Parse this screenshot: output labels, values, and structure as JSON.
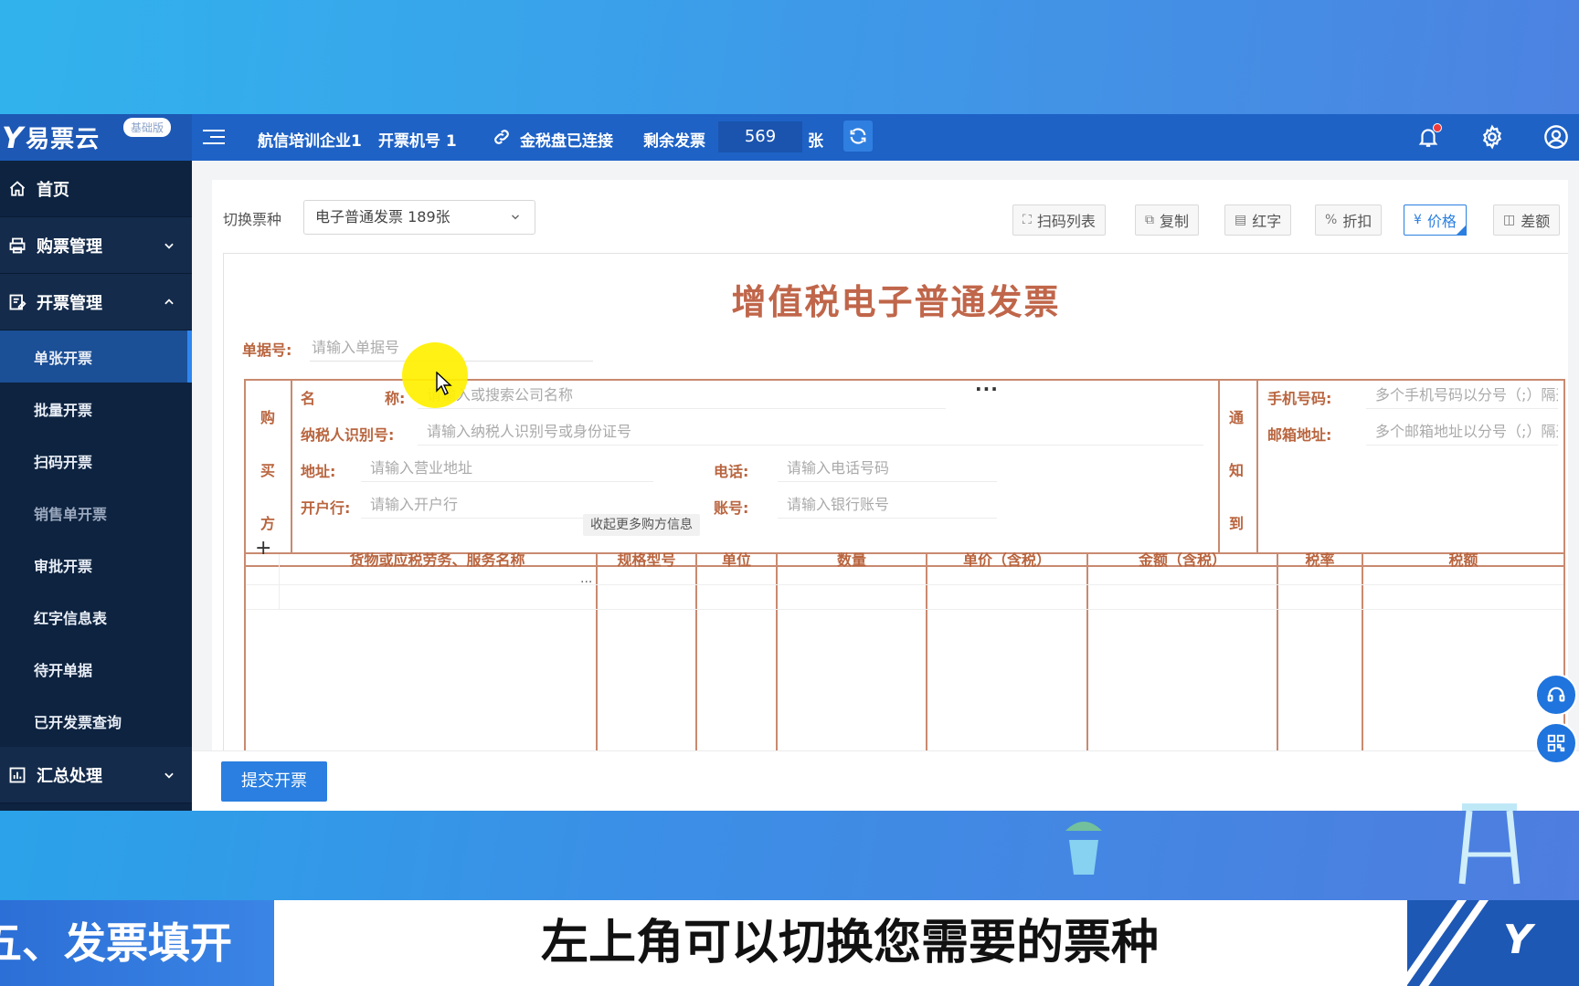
{
  "topbar": {
    "logo_mark": "Y",
    "logo_text": "易票云",
    "edition": "基础版",
    "company": "航信培训企业1",
    "machine": "开票机号 1",
    "tax_disk": "金税盘已连接",
    "remaining_label": "剩余发票",
    "remaining_count": "569",
    "remaining_unit": "张"
  },
  "sidebar": {
    "home": "首页",
    "purchase": "购票管理",
    "issue": "开票管理",
    "items": [
      "单张开票",
      "批量开票",
      "扫码开票",
      "销售单开票",
      "审批开票",
      "红字信息表",
      "待开单据",
      "已开发票查询"
    ],
    "summary": "汇总处理"
  },
  "toolbar": {
    "switch_label": "切换票种",
    "ticket_type": "电子普通发票 189张",
    "buttons": [
      "扫码列表",
      "复制",
      "红字",
      "折扣",
      "价格",
      "差额"
    ]
  },
  "invoice": {
    "title": "增值税电子普通发票",
    "doc_no_label": "单据号:",
    "doc_no_placeholder": "请输入单据号",
    "buyer_chars": [
      "购",
      "买",
      "方"
    ],
    "name_label_a": "名",
    "name_label_b": "称:",
    "name_placeholder": "请输入或搜索公司名称",
    "taxid_label": "纳税人识别号:",
    "taxid_placeholder": "请输入纳税人识别号或身份证号",
    "address_label": "地址:",
    "address_placeholder": "请输入营业地址",
    "phone_label": "电话:",
    "phone_placeholder": "请输入电话号码",
    "bank_label": "开户行:",
    "bank_placeholder": "请输入开户行",
    "account_label": "账号:",
    "account_placeholder": "请输入银行账号",
    "collapse_text": "收起更多购方信息",
    "notify_chars": [
      "通",
      "知",
      "到"
    ],
    "mobile_label": "手机号码:",
    "mobile_placeholder": "多个手机号码以分号（;）隔开",
    "email_label": "邮箱地址:",
    "email_placeholder": "多个邮箱地址以分号（;）隔开",
    "add_row": "+",
    "columns": [
      "货物或应税劳务、服务名称",
      "规格型号",
      "单位",
      "数量",
      "单价（含税）",
      "金额（含税）",
      "税率",
      "税额"
    ]
  },
  "footer": {
    "submit": "提交开票"
  },
  "caption": {
    "section": "五、发票填开",
    "text": "左上角可以切换您需要的票种",
    "corner_logo": "Y"
  },
  "colors": {
    "brand_blue": "#1e62c6",
    "sidebar_dark": "#0d2340",
    "invoice_accent": "#c98a70",
    "title_red": "#c0664a"
  }
}
